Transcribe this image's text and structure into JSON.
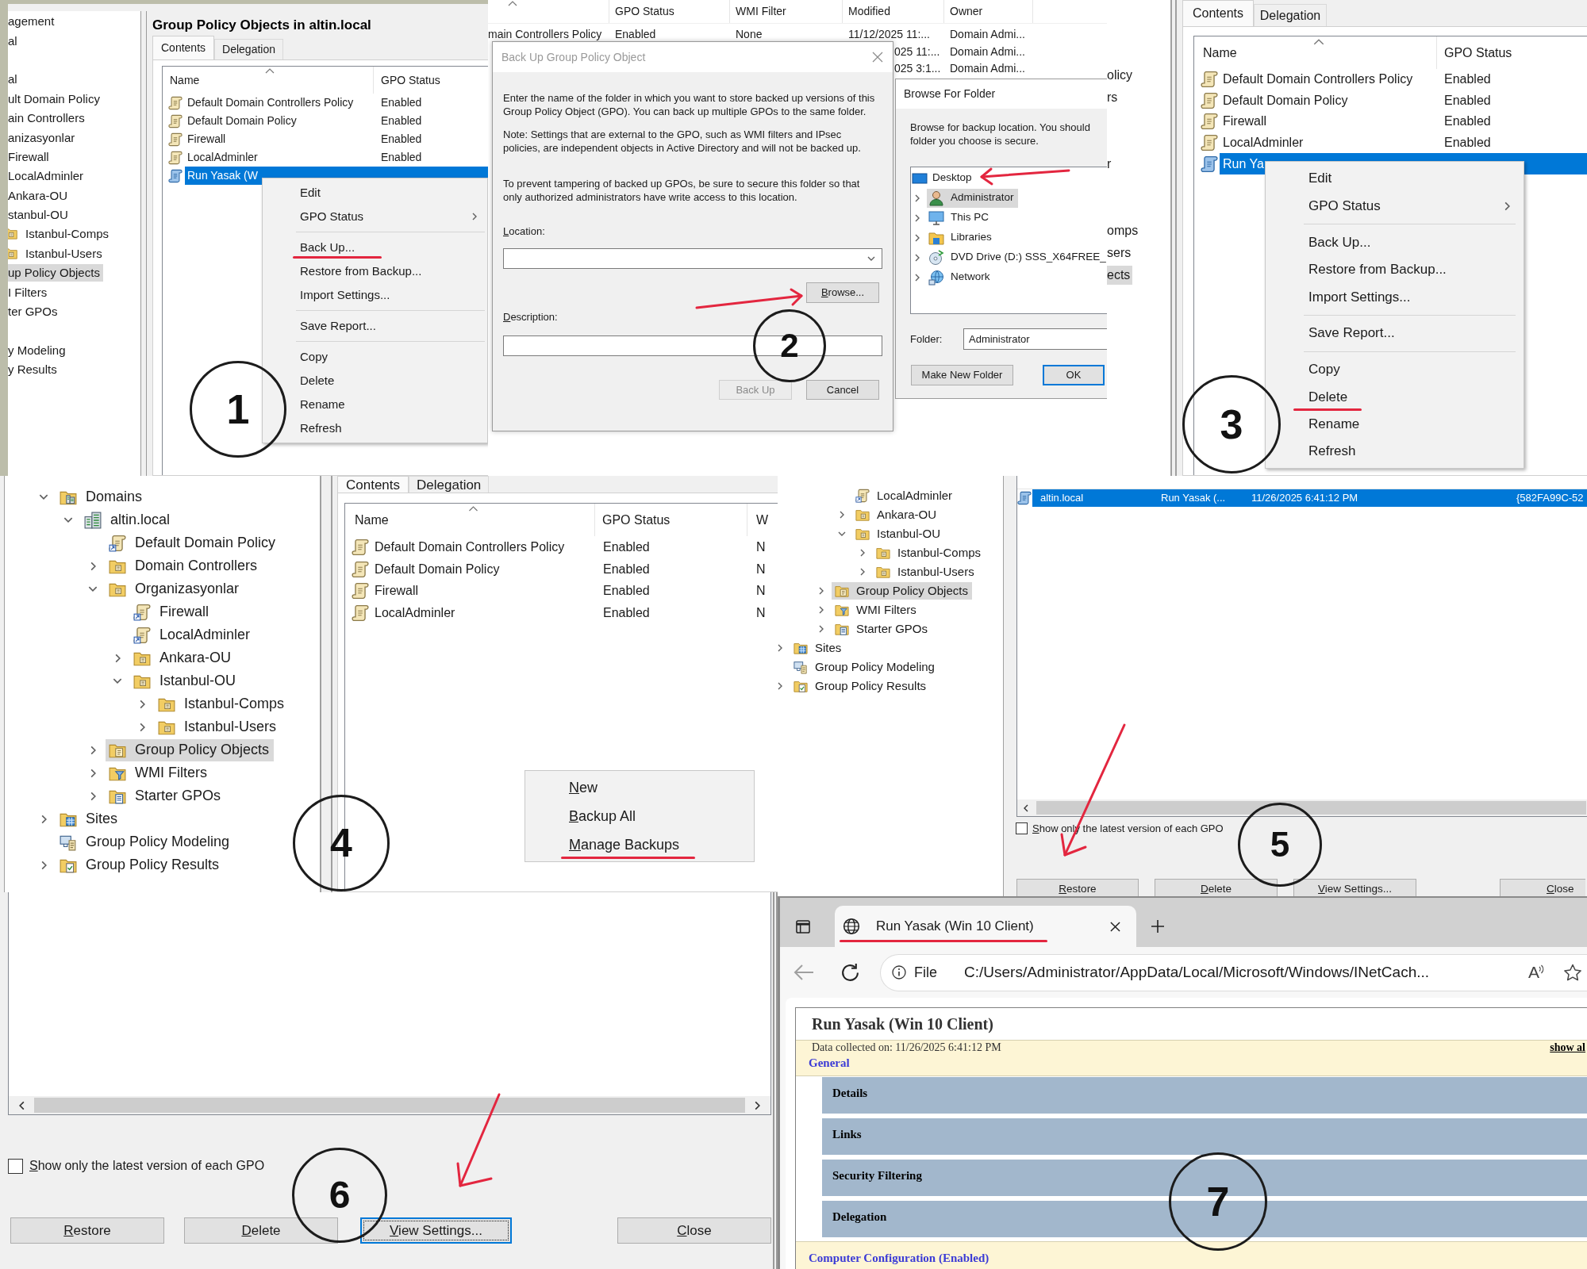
{
  "steps": [
    {
      "kind": "contextmenu",
      "number": "1",
      "tree": [
        {
          "label": "agement",
          "kind": "text",
          "selected": false
        },
        {
          "label": "al",
          "kind": "text",
          "selected": false
        },
        {
          "label": "al",
          "kind": "text",
          "selected": false
        },
        {
          "label": "ult Domain Policy",
          "kind": "text",
          "selected": false
        },
        {
          "label": "ain Controllers",
          "kind": "text",
          "selected": false
        },
        {
          "label": "anizasyonlar",
          "kind": "text",
          "selected": false
        },
        {
          "label": "Firewall",
          "kind": "text",
          "selected": false
        },
        {
          "label": "LocalAdminler",
          "kind": "text",
          "selected": false
        },
        {
          "label": "Ankara-OU",
          "kind": "text",
          "selected": false
        },
        {
          "label": "stanbul-OU",
          "kind": "text",
          "selected": false
        },
        {
          "label": "Istanbul-Comps",
          "kind": "folder",
          "selected": false
        },
        {
          "label": "Istanbul-Users",
          "kind": "folder",
          "selected": false
        },
        {
          "label": "up Policy Objects",
          "kind": "text",
          "selected": true
        },
        {
          "label": "I Filters",
          "kind": "text",
          "selected": false
        },
        {
          "label": "ter GPOs",
          "kind": "text",
          "selected": false
        },
        {
          "label": "y Modeling",
          "kind": "text",
          "selected": false
        },
        {
          "label": "y Results",
          "kind": "text",
          "selected": false
        }
      ],
      "title": "Group Policy Objects in altin.local",
      "tabs": [
        {
          "label": "Contents",
          "selected": true
        },
        {
          "label": "Delegation",
          "selected": false
        }
      ],
      "columns": [
        "Name",
        "GPO Status"
      ],
      "rows": [
        {
          "name": "Default Domain Controllers Policy",
          "status": "Enabled",
          "selected": false
        },
        {
          "name": "Default Domain Policy",
          "status": "Enabled",
          "selected": false
        },
        {
          "name": "Firewall",
          "status": "Enabled",
          "selected": false
        },
        {
          "name": "LocalAdminler",
          "status": "Enabled",
          "selected": false
        },
        {
          "name": "Run Yasak (W",
          "selected": true
        }
      ],
      "menu": [
        [
          {
            "label": "Edit",
            "submenu": false,
            "underlined": false
          },
          {
            "label": "GPO Status",
            "submenu": true,
            "underlined": false
          }
        ],
        [
          {
            "label": "Back Up...",
            "submenu": false,
            "underlined": true
          },
          {
            "label": "Restore from Backup...",
            "submenu": false,
            "underlined": false
          },
          {
            "label": "Import Settings...",
            "submenu": false,
            "underlined": false
          }
        ],
        [
          {
            "label": "Save Report...",
            "submenu": false,
            "underlined": false
          }
        ],
        [
          {
            "label": "Copy",
            "submenu": false,
            "underlined": false
          },
          {
            "label": "Delete",
            "submenu": false,
            "underlined": false
          },
          {
            "label": "Rename",
            "submenu": false,
            "underlined": false
          },
          {
            "label": "Refresh",
            "submenu": false,
            "underlined": false
          }
        ]
      ]
    },
    {
      "kind": "backupdialog",
      "number": "2",
      "list": {
        "columns": [
          {
            "sorted": true
          },
          {
            "label": "GPO Status",
            "sorted": false
          },
          {
            "label": "WMI Filter",
            "sorted": false
          },
          {
            "label": "Modified",
            "sorted": false
          },
          {
            "label": "Owner",
            "sorted": false
          }
        ],
        "rows": [
          {
            "name": "main Controllers Policy",
            "gpo_status": "Enabled",
            "wmi_filter": "None",
            "modified": "11/12/2025 11:...",
            "owner": "Domain Admi..."
          },
          {
            "modified": "025 11:...",
            "owner": "Domain Admi..."
          },
          {
            "modified": "025 3:1...",
            "owner": "Domain Admi..."
          }
        ]
      },
      "dialog": {
        "title": "Back Up Group Policy Object",
        "paragraphs": [
          "Enter the name of the folder in which you want to store backed up versions of this Group Policy Object (GPO). You can back up multiple GPOs to the same folder.",
          "Note: Settings that are external to the GPO, such as WMI filters and IPsec policies, are independent objects in Active Directory and will not be backed up.",
          "To prevent tampering of backed up GPOs, be sure to secure this folder so that only authorized administrators have write access to this location."
        ],
        "location_label": "Location:",
        "browse": {
          "label": "Browse...",
          "arrow": true
        },
        "description_label": "Description:",
        "buttons": [
          {
            "label": "Back Up",
            "disabled": true
          },
          {
            "label": "Cancel",
            "disabled": false
          }
        ]
      },
      "browser": {
        "title": "Browse For Folder",
        "lines": [
          "Browse for backup location. You should",
          "folder you choose is secure."
        ],
        "folders": [
          {
            "label": "Desktop",
            "kind": "desktop",
            "selected": false,
            "arrow": true,
            "children": [
              {
                "label": "Administrator",
                "kind": "user",
                "expanded": false,
                "selected": true,
                "arrow": false
              },
              {
                "label": "This PC",
                "kind": "pc",
                "expanded": false,
                "selected": false,
                "arrow": false
              },
              {
                "label": "Libraries",
                "kind": "libraries",
                "expanded": false,
                "selected": false,
                "arrow": false
              },
              {
                "label": "DVD Drive (D:) SSS_X64FREE_",
                "kind": "dvd",
                "expanded": false,
                "selected": false,
                "arrow": false
              },
              {
                "label": "Network",
                "kind": "network",
                "expanded": false,
                "selected": false,
                "arrow": false
              }
            ]
          }
        ],
        "folder_label": "Folder:",
        "folder_value": "Administrator",
        "buttons": [
          {
            "label": "Make New Folder",
            "default": false
          },
          {
            "label": "OK",
            "default": true
          }
        ]
      }
    },
    {
      "kind": "deletemenu",
      "number": "3",
      "tree": [
        {
          "label": "olicy",
          "selected": false
        },
        {
          "label": "rs",
          "selected": false
        },
        {
          "label": "r",
          "selected": false
        },
        {
          "label": "omps",
          "selected": false
        },
        {
          "label": "sers",
          "selected": false
        },
        {
          "label": "ects",
          "selected": true
        }
      ],
      "tabs": [
        {
          "label": "Contents",
          "selected": true
        },
        {
          "label": "Delegation",
          "selected": false
        }
      ],
      "columns": [
        "Name",
        "GPO Status"
      ],
      "rows": [
        {
          "name": "Default Domain Controllers Policy",
          "status": "Enabled",
          "selected": false
        },
        {
          "name": "Default Domain Policy",
          "status": "Enabled",
          "selected": false
        },
        {
          "name": "Firewall",
          "status": "Enabled",
          "selected": false
        },
        {
          "name": "LocalAdminler",
          "status": "Enabled",
          "selected": false
        },
        {
          "name": "Run Ya",
          "selected": true
        }
      ],
      "menu": [
        [
          {
            "label": "Edit",
            "submenu": false,
            "underlined": false
          },
          {
            "label": "GPO Status",
            "submenu": true,
            "underlined": false
          }
        ],
        [
          {
            "label": "Back Up...",
            "submenu": false,
            "underlined": false
          },
          {
            "label": "Restore from Backup...",
            "submenu": false,
            "underlined": false
          },
          {
            "label": "Import Settings...",
            "submenu": false,
            "underlined": false
          }
        ],
        [
          {
            "label": "Save Report...",
            "submenu": false,
            "underlined": false
          }
        ],
        [
          {
            "label": "Copy",
            "submenu": false,
            "underlined": false
          },
          {
            "label": "Delete",
            "submenu": false,
            "underlined": true
          },
          {
            "label": "Rename",
            "submenu": false,
            "underlined": false
          },
          {
            "label": "Refresh",
            "submenu": false,
            "underlined": false
          }
        ]
      ]
    },
    {
      "kind": "gpotree",
      "number": "4",
      "tree": [
        {
          "label": "Domains",
          "kind": "domains",
          "expanded": true,
          "selected": false,
          "children": [
            {
              "label": "altin.local",
              "kind": "domain",
              "expanded": true,
              "selected": false,
              "children": [
                {
                  "label": "Default Domain Policy",
                  "kind": "link",
                  "selected": false
                },
                {
                  "label": "Domain Controllers",
                  "kind": "ou",
                  "expanded": false,
                  "selected": false
                },
                {
                  "label": "Organizasyonlar",
                  "kind": "ou",
                  "expanded": true,
                  "selected": false,
                  "children": [
                    {
                      "label": "Firewall",
                      "kind": "link",
                      "selected": false
                    },
                    {
                      "label": "LocalAdminler",
                      "kind": "link",
                      "selected": false
                    },
                    {
                      "label": "Ankara-OU",
                      "kind": "ou",
                      "expanded": false,
                      "selected": false
                    },
                    {
                      "label": "Istanbul-OU",
                      "kind": "ou",
                      "expanded": true,
                      "selected": false,
                      "children": [
                        {
                          "label": "Istanbul-Comps",
                          "kind": "ou",
                          "expanded": false,
                          "selected": false
                        },
                        {
                          "label": "Istanbul-Users",
                          "kind": "ou",
                          "expanded": false,
                          "selected": false
                        }
                      ]
                    }
                  ]
                },
                {
                  "label": "Group Policy Objects",
                  "kind": "gpos",
                  "expanded": false,
                  "selected": true
                },
                {
                  "label": "WMI Filters",
                  "kind": "wmi",
                  "expanded": false,
                  "selected": false
                },
                {
                  "label": "Starter GPOs",
                  "kind": "starter",
                  "expanded": false,
                  "selected": false
                }
              ]
            }
          ]
        },
        {
          "label": "Sites",
          "kind": "sites",
          "expanded": false,
          "selected": false
        },
        {
          "label": "Group Policy Modeling",
          "kind": "modeling",
          "selected": false
        },
        {
          "label": "Group Policy Results",
          "kind": "results",
          "expanded": false,
          "selected": false
        }
      ],
      "tabs": [
        {
          "label": "Contents",
          "selected": true
        },
        {
          "label": "Delegation",
          "selected": false
        }
      ],
      "columns": [
        "Name",
        "GPO Status",
        "W"
      ],
      "rows": [
        {
          "cells": [
            "Default Domain Controllers Policy",
            "Enabled",
            "N"
          ]
        },
        {
          "cells": [
            "Default Domain Policy",
            "Enabled",
            "N"
          ]
        },
        {
          "cells": [
            "Firewall",
            "Enabled",
            "N"
          ]
        },
        {
          "cells": [
            "LocalAdminler",
            "Enabled",
            "N"
          ]
        }
      ],
      "menu": [
        {
          "label": "New",
          "underlined": false
        },
        {
          "label": "Backup All",
          "underlined": false
        },
        {
          "label": "Manage Backups",
          "underlined": true
        }
      ]
    },
    {
      "kind": "backuplist",
      "number": "5",
      "tree": [
        {
          "children": [
            {
              "children": [
                {
                  "children": [
                    {
                      "label": "LocalAdminler",
                      "kind": "link",
                      "selected": false
                    },
                    {
                      "label": "Ankara-OU",
                      "kind": "ou",
                      "expanded": false,
                      "selected": false
                    },
                    {
                      "label": "Istanbul-OU",
                      "kind": "ou",
                      "expanded": true,
                      "selected": false,
                      "children": [
                        {
                          "label": "Istanbul-Comps",
                          "kind": "ou",
                          "expanded": false,
                          "selected": false
                        },
                        {
                          "label": "Istanbul-Users",
                          "kind": "ou",
                          "expanded": false,
                          "selected": false
                        }
                      ]
                    }
                  ]
                },
                {
                  "label": "Group Policy Objects",
                  "kind": "gpos",
                  "expanded": false,
                  "selected": true
                },
                {
                  "label": "WMI Filters",
                  "kind": "wmi",
                  "expanded": false,
                  "selected": false
                },
                {
                  "label": "Starter GPOs",
                  "kind": "starter",
                  "expanded": false,
                  "selected": false
                }
              ]
            }
          ]
        },
        {
          "label": "Sites",
          "kind": "sites",
          "expanded": false,
          "selected": false
        },
        {
          "label": "Group Policy Modeling",
          "kind": "modeling",
          "selected": false
        },
        {
          "label": "Group Policy Results",
          "kind": "results",
          "expanded": false,
          "selected": false
        }
      ],
      "rows": [
        {
          "domain": "altin.local",
          "name": "Run Yasak (...",
          "time_stamp": "11/26/2025 6:41:12 PM",
          "gpo_id": "{582FA99C-52",
          "selected": true
        }
      ],
      "latest_only": {
        "label": "Show only the latest version of each GPO",
        "checked": false
      },
      "buttons": [
        {
          "label": "Restore",
          "arrow": true
        },
        {
          "label": "Delete",
          "arrow": false
        },
        {
          "label": "View Settings...",
          "arrow": false
        },
        {
          "label": "Close",
          "arrow": false
        }
      ]
    },
    {
      "kind": "backupbuttons",
      "number": "6",
      "latest_only": {
        "label": "Show only the latest version of each GPO",
        "checked": false
      },
      "buttons": [
        {
          "label": "Restore",
          "focused": false,
          "arrow": false
        },
        {
          "label": "Delete",
          "focused": false,
          "arrow": false
        },
        {
          "label": "View Settings...",
          "focused": true,
          "arrow": true
        },
        {
          "label": "Close",
          "focused": false,
          "arrow": false
        }
      ]
    },
    {
      "kind": "report",
      "number": "7",
      "tab": {
        "title": "Run Yasak (Win 10 Client)",
        "underlined": true
      },
      "address": {
        "scheme": "File",
        "url": "C:/Users/Administrator/AppData/Local/Microsoft/Windows/INetCach...",
        "read_aloud": "A"
      },
      "report": {
        "title": "Run Yasak (Win 10 Client)",
        "collected": "Data collected on: 11/26/2025 6:41:12 PM",
        "show_all": "show al",
        "sections": [
          {
            "label": "General",
            "children": [
              {
                "label": "Details"
              },
              {
                "label": "Links"
              },
              {
                "label": "Security Filtering"
              },
              {
                "label": "Delegation"
              }
            ]
          },
          {
            "label": "Computer Configuration (Enabled)"
          }
        ]
      }
    }
  ]
}
